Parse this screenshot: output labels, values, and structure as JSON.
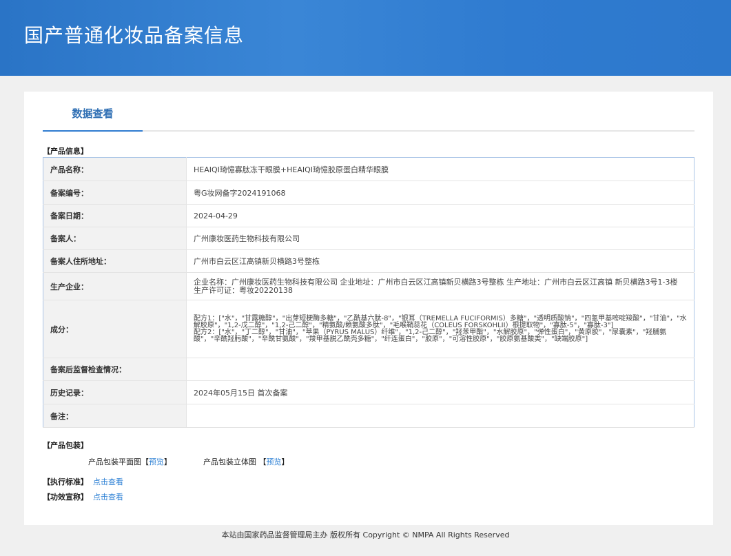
{
  "header": {
    "title": "国产普通化妆品备案信息"
  },
  "tab": {
    "label": "数据查看"
  },
  "product_info": {
    "section_title": "【产品信息】",
    "rows": [
      {
        "label": "产品名称：",
        "value": "HEAIQI琦憶寡肽冻干眼膜+HEAIQI琦憶胶原蛋白精华眼膜"
      },
      {
        "label": "备案编号：",
        "value": "粤G妆网备字2024191068"
      },
      {
        "label": "备案日期：",
        "value": "2024-04-29"
      },
      {
        "label": "备案人：",
        "value": "广州康妆医药生物科技有限公司"
      },
      {
        "label": "备案人住所地址：",
        "value": "广州市白云区江高镇新贝横路3号整栋"
      },
      {
        "label": "生产企业：",
        "value": "企业名称：广州康妆医药生物科技有限公司 企业地址：广州市白云区江高镇新贝横路3号整栋 生产地址：广州市白云区江高镇 新贝横路3号1-3楼 生产许可证：粤妆20220138"
      },
      {
        "label": "成分：",
        "value": "配方1：[\"水\"，\"甘露糖醇\"，\"出芽短梗酶多糖\"，\"乙酰基六肽-8\"，\"银耳（TREMELLA FUCIFORMIS）多糖\"，\"透明质酸钠\"，\"四氢甲基嘧啶羧酸\"，\"甘油\"，\"水解胶原\"，\"1,2-戊二醇\"，\"1,2-己二醇\"，\"精氨酸/赖氨酸多肽\"，\"毛喉鞘蕊花（COLEUS FORSKOHLII）根提取物\"，\"寡肽-5\"，\"寡肽-3\"]",
        "value2": "配方2：[\"水\"，\"丁二醇\"，\"甘油\"，\"苹果（PYRUS MALUS）纤维\"，\"1,2-己二醇\"，\"羟苯甲酯\"，\"水解胶原\"，\"弹性蛋白\"，\"黄原胶\"，\"尿囊素\"，\"羟脯氨酸\"，\"辛酰羟肟酸\"，\"辛酰甘氨酸\"，\"羧甲基脱乙酰壳多糖\"，\"纤连蛋白\"，\"胶原\"，\"可溶性胶原\"，\"胶原氨基酸类\"，\"缺端胶原\"]"
      },
      {
        "label": "备案后监督检查情况：",
        "value": ""
      },
      {
        "label": "历史记录：",
        "value": "2024年05月15日 首次备案"
      },
      {
        "label": "备注：",
        "value": ""
      }
    ]
  },
  "packaging": {
    "section_title": "【产品包装】",
    "flat_label": "产品包装平面图",
    "stereo_label": "产品包装立体图",
    "open": "【",
    "close": "】",
    "preview": "预览"
  },
  "standard": {
    "label": "【执行标准】",
    "link": "点击查看"
  },
  "efficacy": {
    "label": "【功效宣称】",
    "link": "点击查看"
  },
  "footer": {
    "text": "本站由国家药品监督管理局主办 版权所有 Copyright © NMPA All Rights Reserved"
  }
}
